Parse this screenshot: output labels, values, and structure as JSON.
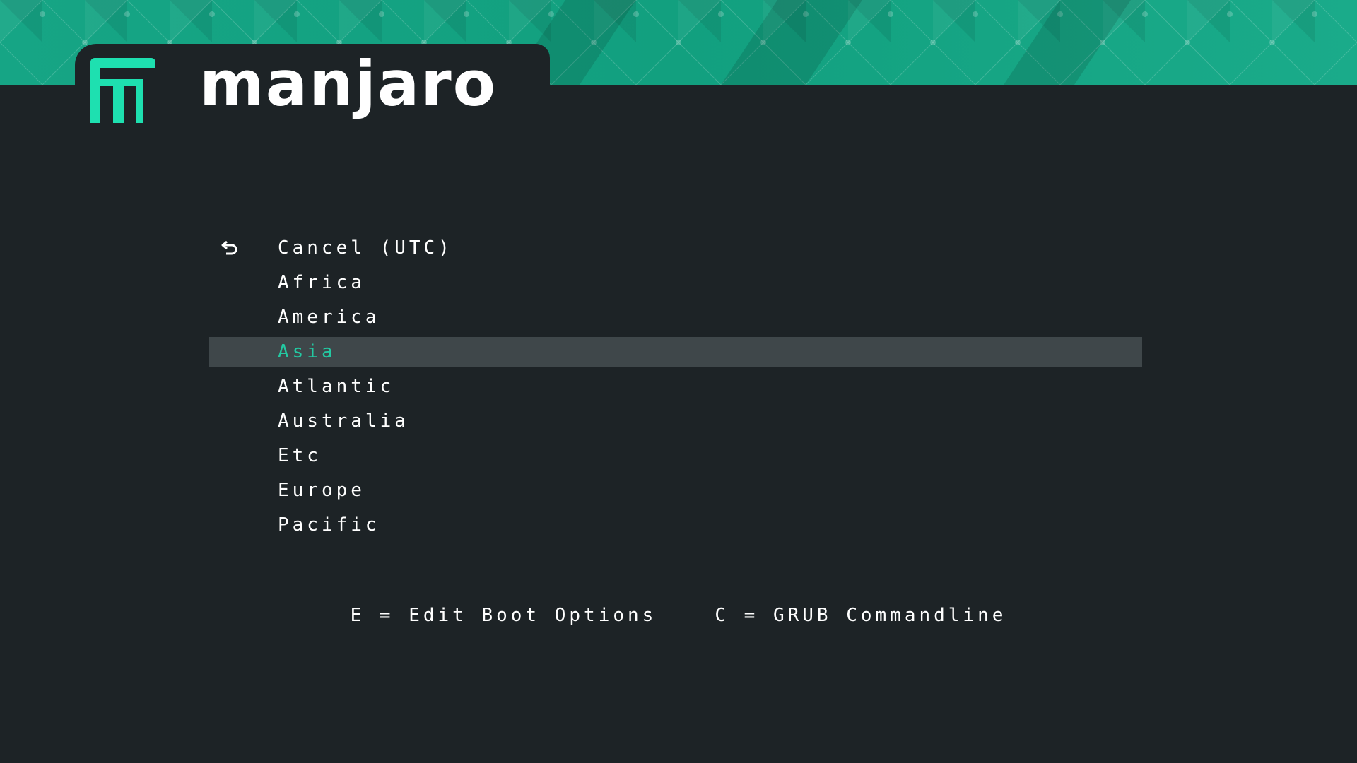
{
  "branding": {
    "logo_text": "manjaro",
    "accent_color": "#23c9a2",
    "background_color": "#1d2326",
    "selection_color": "#3f474a"
  },
  "menu": {
    "items": [
      {
        "label": "Cancel (UTC)",
        "icon": "return-arrow-icon"
      },
      {
        "label": "Africa"
      },
      {
        "label": "America"
      },
      {
        "label": "Asia",
        "selected": true
      },
      {
        "label": "Atlantic"
      },
      {
        "label": "Australia"
      },
      {
        "label": "Etc"
      },
      {
        "label": "Europe"
      },
      {
        "label": "Pacific"
      }
    ]
  },
  "hints": {
    "edit": "E = Edit Boot Options",
    "commandline": "C = GRUB Commandline"
  }
}
